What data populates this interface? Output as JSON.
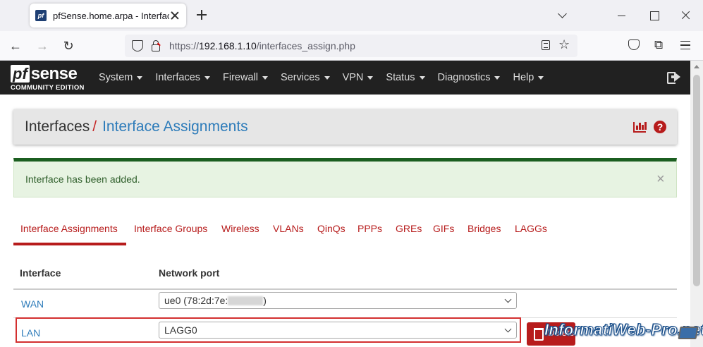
{
  "browser": {
    "tab_title": "pfSense.home.arpa - Interfaces: A",
    "favicon_text": "pf",
    "url_prefix": "https://",
    "url_host": "192.168.1.10",
    "url_path": "/interfaces_assign.php"
  },
  "pfsense": {
    "logo_pf": "pf",
    "logo_sense": "sense",
    "logo_sub": "COMMUNITY EDITION",
    "menu": [
      "System",
      "Interfaces",
      "Firewall",
      "Services",
      "VPN",
      "Status",
      "Diagnostics",
      "Help"
    ]
  },
  "breadcrumb": {
    "parent": "Interfaces",
    "separator": "/",
    "current": "Interface Assignments",
    "help_glyph": "?"
  },
  "alert": {
    "message": "Interface has been added.",
    "close": "×"
  },
  "tabs": [
    "Interface Assignments",
    "Interface Groups",
    "Wireless",
    "VLANs",
    "QinQs",
    "PPPs",
    "GREs",
    "GIFs",
    "Bridges",
    "LAGGs"
  ],
  "table": {
    "headers": [
      "Interface",
      "Network port"
    ],
    "rows": [
      {
        "name": "WAN",
        "port_prefix": "ue0 (78:2d:7e:",
        "port_suffix": ")"
      },
      {
        "name": "LAN",
        "port_prefix": "LAGG0",
        "port_suffix": ""
      }
    ],
    "delete_label": "Delete"
  },
  "watermark": "InformatiWeb-Pro.net",
  "colors": {
    "accent_red": "#b71c1c",
    "link_blue": "#2e7cba",
    "nav_bg": "#212121",
    "success_border": "#1b5e20"
  }
}
